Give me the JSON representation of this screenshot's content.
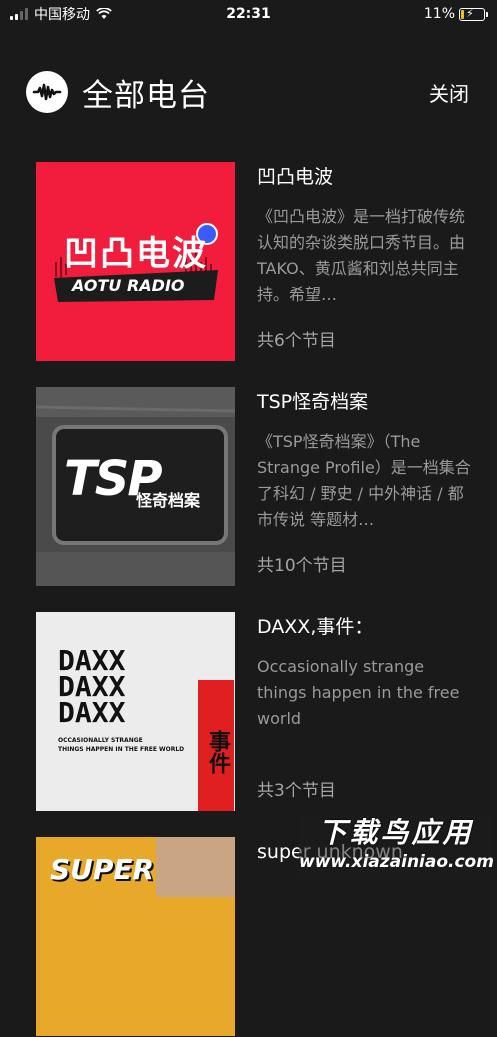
{
  "status": {
    "carrier": "中国移动",
    "time": "22:31",
    "battery": "11%",
    "battery_level": 0.11
  },
  "header": {
    "title": "全部电台",
    "close_label": "关闭",
    "logo_icon": "soundwave-icon"
  },
  "stations": [
    {
      "name": "凹凸电波",
      "description": "《凹凸电波》是一档打破传统认知的杂谈类脱口秀节目。由TAKO、黄瓜酱和刘总共同主持。希望…",
      "count": "共6个节目",
      "cover_text": "凹凸电波",
      "cover_sub": "AOTU RADIO",
      "cover_color": "#f21d3c"
    },
    {
      "name": "TSP怪奇档案",
      "description": "《TSP怪奇档案》（The Strange Profile）是一档集合了科幻 / 野史 / 中外神话 / 都市传说 等题材…",
      "count": "共10个节目",
      "cover_text": "TSP",
      "cover_sub": "怪奇档案"
    },
    {
      "name": "DAXX,事件：",
      "description": "Occasionally strange things happen in the free world",
      "count": "共3个节目",
      "cover_lines": [
        "DAXX",
        "DAXX",
        "DAXX"
      ],
      "cover_sub1": "OCCASIONALLY STRANGE",
      "cover_sub2": "THINGS HAPPEN IN THE FREE WORLD",
      "cover_side": "事件"
    },
    {
      "name": "super unknown",
      "cover_text": "SUPER"
    }
  ],
  "watermark": {
    "line1": "下载鸟应用",
    "line2": "www.xiazainiao.com"
  }
}
